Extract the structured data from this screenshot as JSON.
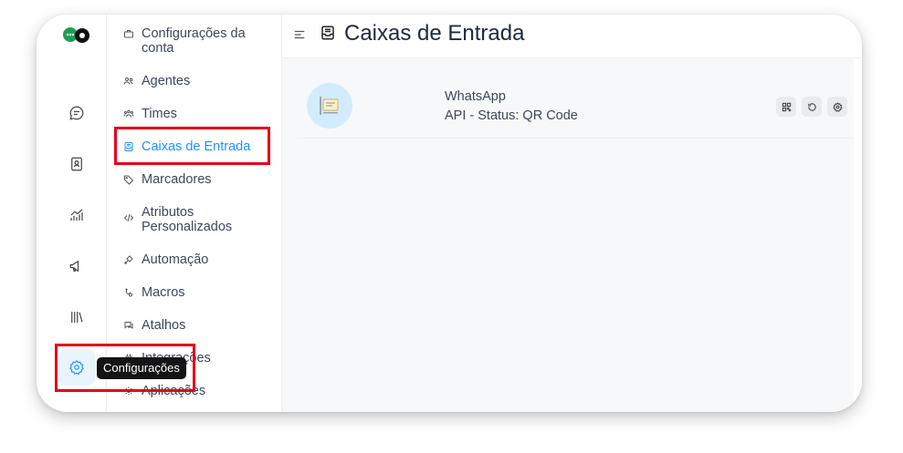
{
  "rail": {
    "items": [
      {
        "name": "conversations-icon"
      },
      {
        "name": "contacts-icon"
      },
      {
        "name": "reports-icon"
      },
      {
        "name": "campaigns-icon"
      },
      {
        "name": "library-icon"
      },
      {
        "name": "settings-icon"
      }
    ],
    "tooltip": "Configurações"
  },
  "sidebar": {
    "items": [
      {
        "label": "Configurações da conta",
        "icon": "briefcase-icon"
      },
      {
        "label": "Agentes",
        "icon": "people-icon"
      },
      {
        "label": "Times",
        "icon": "team-icon"
      },
      {
        "label": "Caixas de Entrada",
        "icon": "inbox-icon",
        "active": true
      },
      {
        "label": "Marcadores",
        "icon": "tag-icon"
      },
      {
        "label": "Atributos Personalizados",
        "icon": "code-icon"
      },
      {
        "label": "Automação",
        "icon": "automation-icon"
      },
      {
        "label": "Macros",
        "icon": "macros-icon"
      },
      {
        "label": "Atalhos",
        "icon": "chat-icon"
      },
      {
        "label": "Integrações",
        "icon": "plug-icon"
      },
      {
        "label": "Aplicações",
        "icon": "apps-icon"
      }
    ]
  },
  "header": {
    "title": "Caixas de Entrada"
  },
  "inboxes": [
    {
      "name": "WhatsApp",
      "status": "API - Status: QR Code"
    }
  ],
  "colors": {
    "accent": "#1f93ff",
    "highlight": "#e3001b"
  }
}
